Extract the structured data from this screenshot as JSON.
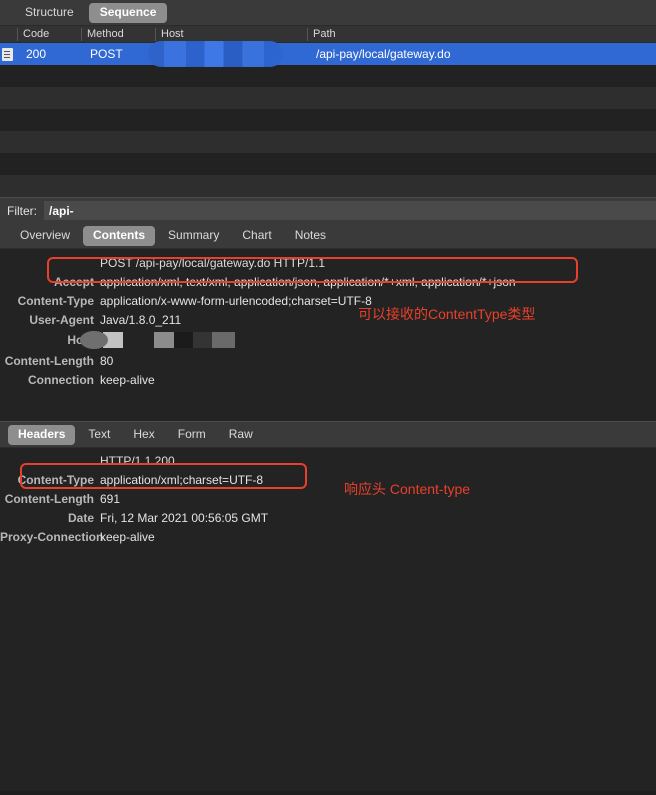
{
  "topbar": {
    "segments": [
      {
        "label": "Structure",
        "active": false
      },
      {
        "label": "Sequence",
        "active": true
      }
    ]
  },
  "request_list": {
    "columns": [
      "",
      "Code",
      "Method",
      "Host",
      "Path"
    ],
    "rows": [
      {
        "icon": "document-icon",
        "code": "200",
        "method": "POST",
        "host": "",
        "host_redacted": true,
        "path": "/api-pay/local/gateway.do",
        "selected": true
      }
    ],
    "empty_row_count": 6,
    "selection_color": "#3069d3"
  },
  "filter": {
    "label": "Filter:",
    "value": "/api-",
    "placeholder": ""
  },
  "request_tabs": [
    {
      "label": "Overview",
      "active": false
    },
    {
      "label": "Contents",
      "active": true
    },
    {
      "label": "Summary",
      "active": false
    },
    {
      "label": "Chart",
      "active": false
    },
    {
      "label": "Notes",
      "active": false
    }
  ],
  "request_headers": {
    "request_line": "POST /api-pay/local/gateway.do HTTP/1.1",
    "lines": [
      {
        "key": "Accept",
        "value": "application/xml, text/xml, application/json, application/*+xml, application/*+json",
        "highlighted": true
      },
      {
        "key": "Content-Type",
        "value": "application/x-www-form-urlencoded;charset=UTF-8",
        "highlighted": false
      },
      {
        "key": "User-Agent",
        "value": "Java/1.8.0_211",
        "highlighted": false
      },
      {
        "key": "Host",
        "value": "",
        "redacted": true,
        "highlighted": false
      },
      {
        "key": "Content-Length",
        "value": "80",
        "highlighted": false
      },
      {
        "key": "Connection",
        "value": "keep-alive",
        "highlighted": false
      }
    ]
  },
  "response_tabs": [
    {
      "label": "Headers",
      "active": true
    },
    {
      "label": "Text",
      "active": false
    },
    {
      "label": "Hex",
      "active": false
    },
    {
      "label": "Form",
      "active": false
    },
    {
      "label": "Raw",
      "active": false
    }
  ],
  "response_headers": {
    "status_line": "HTTP/1.1 200",
    "lines": [
      {
        "key": "Content-Type",
        "value": "application/xml;charset=UTF-8",
        "highlighted": true
      },
      {
        "key": "Content-Length",
        "value": "691",
        "highlighted": false
      },
      {
        "key": "Date",
        "value": "Fri, 12 Mar 2021 00:56:05 GMT",
        "highlighted": false
      },
      {
        "key": "Proxy-Connection",
        "value": "keep-alive",
        "highlighted": false
      }
    ]
  },
  "annotations": [
    {
      "text": "可以接收的ContentType类型",
      "color": "#e8402a"
    },
    {
      "text": "响应头 Content-type",
      "color": "#e8402a"
    }
  ],
  "colors": {
    "background": "#1e1e1e",
    "panel": "#232323",
    "toolbar": "#3a3a3a",
    "accent_blue": "#3069d3",
    "annotation_red": "#e8402a",
    "tab_active_bg": "#8e8e8e"
  }
}
